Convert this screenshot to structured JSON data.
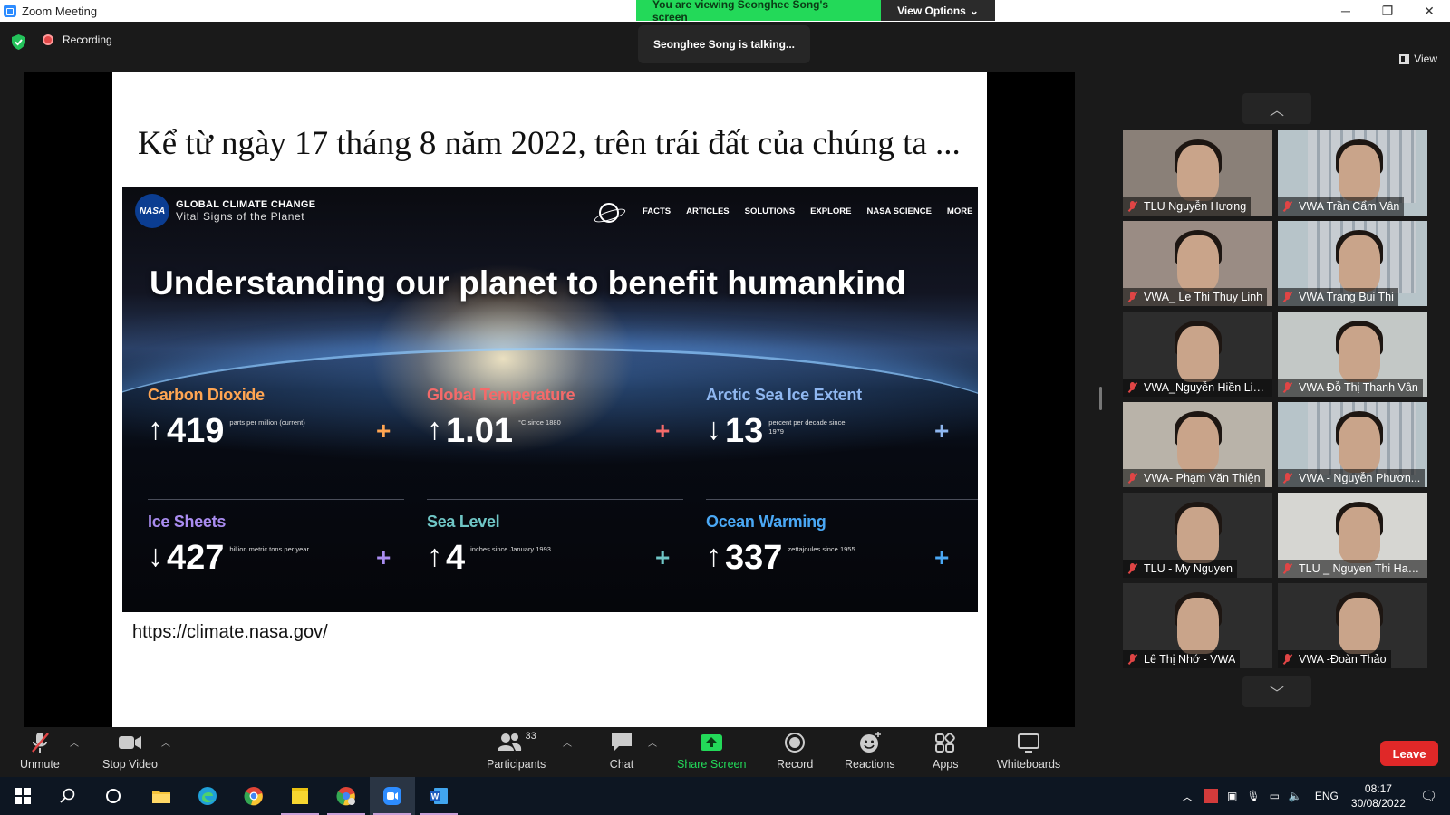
{
  "window": {
    "title": "Zoom Meeting",
    "controls": [
      "─",
      "❐",
      "✕"
    ]
  },
  "share_banner": {
    "viewing_text": "You are viewing Seonghee Song's screen",
    "view_options": "View Options"
  },
  "topbar": {
    "recording_label": "Recording",
    "talking_text": "Seonghee Song is talking...",
    "view_label": "View"
  },
  "slide": {
    "title": "Kể từ ngày 17 tháng 8 năm 2022, trên trái đất của chúng ta ...",
    "url": "https://climate.nasa.gov/",
    "nasa": {
      "logo_text": "NASA",
      "brand_line1": "GLOBAL CLIMATE CHANGE",
      "brand_line2": "Vital Signs of the Planet",
      "menu": [
        "FACTS",
        "ARTICLES",
        "SOLUTIONS",
        "EXPLORE",
        "NASA SCIENCE",
        "MORE"
      ],
      "hero_title": "Understanding our planet to benefit humankind",
      "metrics": [
        {
          "name": "Carbon Dioxide",
          "arrow": "↑",
          "value": "419",
          "unit": "parts per million (current)",
          "color": "#ffa552",
          "plus_color": "#ffa552"
        },
        {
          "name": "Global Temperature",
          "arrow": "↑",
          "value": "1.01",
          "unit": "°C since 1880",
          "color": "#f46a6a",
          "plus_color": "#f46a6a"
        },
        {
          "name": "Arctic Sea Ice Extent",
          "arrow": "↓",
          "value": "13",
          "unit": "percent per decade since 1979",
          "color": "#8fb7f0",
          "plus_color": "#8fb7f0"
        },
        {
          "name": "Ice Sheets",
          "arrow": "↓",
          "value": "427",
          "unit": "billion metric tons per year",
          "color": "#a98cf0",
          "plus_color": "#a98cf0"
        },
        {
          "name": "Sea Level",
          "arrow": "↑",
          "value": "4",
          "unit": "inches since January 1993",
          "color": "#6fc6c6",
          "plus_color": "#6fc6c6"
        },
        {
          "name": "Ocean Warming",
          "arrow": "↑",
          "value": "337",
          "unit": "zettajoules since 1955",
          "color": "#4aa8f5",
          "plus_color": "#4aa8f5"
        }
      ]
    }
  },
  "gallery": {
    "up_icon": "chevron-up-icon",
    "down_icon": "chevron-down-icon",
    "participants": [
      {
        "name": "TLU Nguyễn Hương",
        "bg": "#8a8078"
      },
      {
        "name": "VWA Trần Cẩm Vân",
        "bg": "#b7c4c9"
      },
      {
        "name": "VWA_ Le Thi Thuy Linh",
        "bg": "#9a8c84"
      },
      {
        "name": "VWA Trang Bui Thi",
        "bg": "#b7c4c9"
      },
      {
        "name": "VWA_Nguyễn Hiền Lin...",
        "bg": "#2d2d2d"
      },
      {
        "name": "VWA Đỗ Thị Thanh Vân",
        "bg": "#c3c8c6"
      },
      {
        "name": "VWA- Phạm Văn Thiện",
        "bg": "#b9b3a9"
      },
      {
        "name": "VWA - Nguyễn Phươn...",
        "bg": "#b7c4c9"
      },
      {
        "name": "TLU - My Nguyen",
        "bg": "#2d2d2d"
      },
      {
        "name": "TLU _ Nguyen Thi Han...",
        "bg": "#d6d6d2"
      },
      {
        "name": "Lê Thị Nhớ - VWA",
        "bg": "#2d2d2d"
      },
      {
        "name": "VWA -Đoàn Thảo",
        "bg": "#2d2d2d"
      }
    ]
  },
  "toolbar": {
    "unmute": "Unmute",
    "stop_video": "Stop Video",
    "participants": "Participants",
    "participants_count": "33",
    "chat": "Chat",
    "share_screen": "Share Screen",
    "record": "Record",
    "reactions": "Reactions",
    "apps": "Apps",
    "whiteboards": "Whiteboards",
    "leave": "Leave"
  },
  "taskbar": {
    "lang": "ENG",
    "time": "08:17",
    "date": "30/08/2022"
  }
}
